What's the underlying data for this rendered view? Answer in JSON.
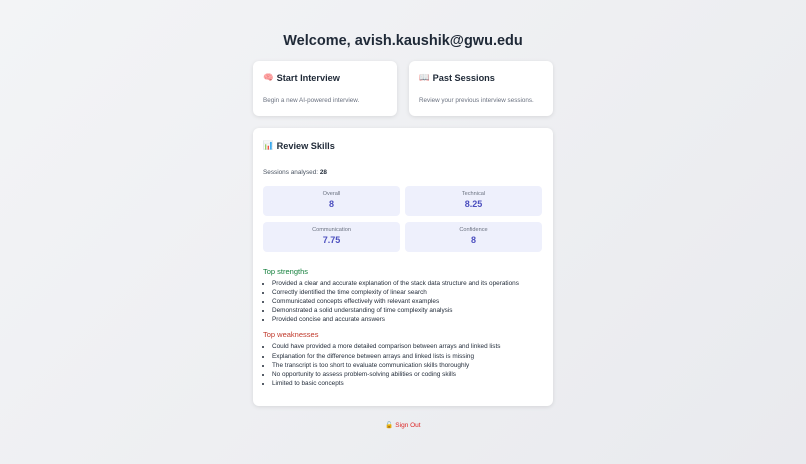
{
  "header": {
    "welcome": "Welcome, avish.kaushik@gwu.edu"
  },
  "cards": {
    "start": {
      "icon": "🧠",
      "title": "Start Interview",
      "desc": "Begin a new AI-powered interview."
    },
    "past": {
      "icon": "📖",
      "title": "Past Sessions",
      "desc": "Review your previous interview sessions."
    }
  },
  "review": {
    "icon": "📊",
    "title": "Review Skills",
    "sessions_label": "Sessions analysed:",
    "sessions_count": "28",
    "stats": [
      {
        "label": "Overall",
        "value": "8"
      },
      {
        "label": "Technical",
        "value": "8.25"
      },
      {
        "label": "Communication",
        "value": "7.75"
      },
      {
        "label": "Confidence",
        "value": "8"
      }
    ],
    "strengths_title": "Top strengths",
    "strengths": [
      "Provided a clear and accurate explanation of the stack data structure and its operations",
      "Correctly identified the time complexity of linear search",
      "Communicated concepts effectively with relevant examples",
      "Demonstrated a solid understanding of time complexity analysis",
      "Provided concise and accurate answers"
    ],
    "weaknesses_title": "Top weaknesses",
    "weaknesses": [
      "Could have provided a more detailed comparison between arrays and linked lists",
      "Explanation for the difference between arrays and linked lists is missing",
      "The transcript is too short to evaluate communication skills thoroughly",
      "No opportunity to assess problem-solving abilities or coding skills",
      "Limited to basic concepts"
    ]
  },
  "footer": {
    "signout_icon": "🔓",
    "signout_label": "Sign Out"
  },
  "colors": {
    "accent": "#4c4fbf",
    "strength": "#15803d",
    "weakness": "#c0392b",
    "signout": "#dc2626"
  }
}
